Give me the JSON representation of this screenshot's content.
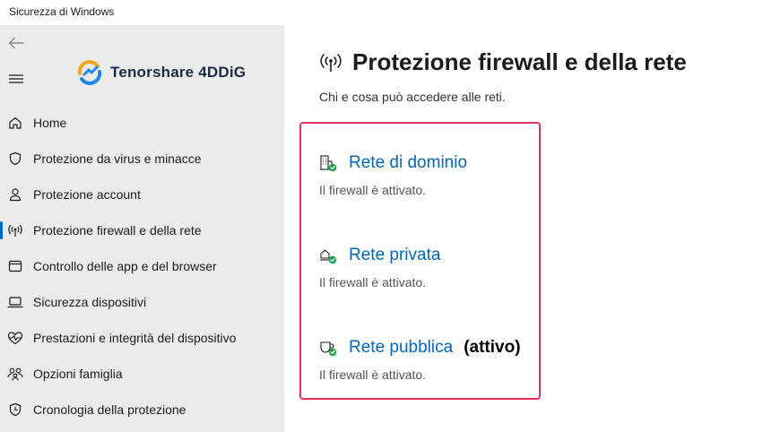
{
  "window": {
    "title": "Sicurezza di Windows"
  },
  "brand": {
    "name": "Tenorshare 4DDiG"
  },
  "sidebar": {
    "items": [
      {
        "label": "Home",
        "icon": "home-icon",
        "active": false
      },
      {
        "label": "Protezione da virus e minacce",
        "icon": "shield-icon",
        "active": false
      },
      {
        "label": "Protezione account",
        "icon": "person-icon",
        "active": false
      },
      {
        "label": "Protezione firewall e della rete",
        "icon": "wireless-icon",
        "active": true
      },
      {
        "label": "Controllo delle app e del browser",
        "icon": "browser-window-icon",
        "active": false
      },
      {
        "label": "Sicurezza dispositivi",
        "icon": "laptop-icon",
        "active": false
      },
      {
        "label": "Prestazioni e integrità del dispositivo",
        "icon": "heart-pulse-icon",
        "active": false
      },
      {
        "label": "Opzioni famiglia",
        "icon": "family-icon",
        "active": false
      },
      {
        "label": "Cronologia della protezione",
        "icon": "history-icon",
        "active": false
      }
    ]
  },
  "main": {
    "title": "Protezione firewall e della rete",
    "subtitle": "Chi e cosa può accedere alle reti.",
    "networks": [
      {
        "name": "Rete di dominio",
        "status": "Il firewall è attivato.",
        "active_label": "",
        "icon": "domain-network-icon"
      },
      {
        "name": "Rete privata",
        "status": "Il firewall è attivato.",
        "active_label": "",
        "icon": "private-network-icon"
      },
      {
        "name": "Rete pubblica",
        "status": "Il firewall è attivato.",
        "active_label": "(attivo)",
        "icon": "public-network-icon"
      }
    ]
  },
  "colors": {
    "accent": "#0067c0",
    "highlight_border": "#e5345a",
    "check_green": "#16a34a",
    "sidebar_bg": "#ebebeb"
  }
}
